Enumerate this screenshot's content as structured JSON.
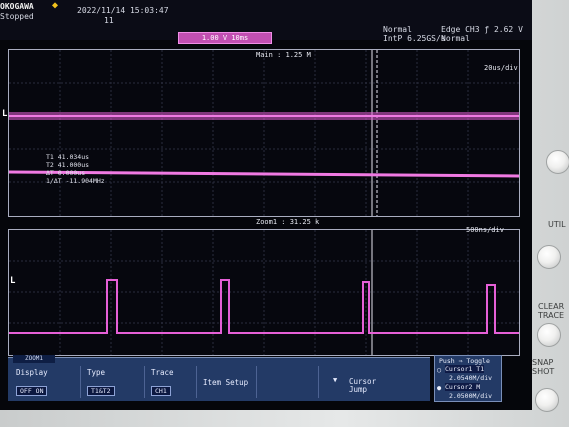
{
  "header": {
    "brand": "OKOGAWA",
    "run_state": "Stopped",
    "datetime": "2022/11/14 15:03:47",
    "acq_count": "11",
    "trigger_bar": "1.00 V 10ms",
    "acq_mode": "Normal",
    "sample_rate": "IntP 6.25GS/s",
    "trigger_info": "Edge CH3 ƒ 2.62 V",
    "trigger_mode": "Normal"
  },
  "main_window": {
    "title": "Main : 1.25 M",
    "time_div": "20us/div",
    "marker": "L"
  },
  "cursor_readout": {
    "t1": "T1  41.034us",
    "t2": "T2  41.000us",
    "dt": "ΔT  0.000us",
    "inv_dt": "1/ΔT  -11.904MHz"
  },
  "zoom_window": {
    "title": "Zoom1 : 31.25 k",
    "time_div": "500ns/div",
    "marker": "L"
  },
  "menu": {
    "title": "ZOOM1",
    "items": [
      {
        "heading": "Display",
        "value": "OFF  ON"
      },
      {
        "heading": "Type",
        "value": "T1&T2"
      },
      {
        "heading": "Trace",
        "value": "CH1"
      },
      {
        "heading": "Item Setup",
        "value": ""
      },
      {
        "heading": "",
        "value": ""
      },
      {
        "heading": "Cursor Jump",
        "value": ""
      }
    ]
  },
  "readout_box": {
    "line1": "Push ⇒ Toggle",
    "line2": "Cursor1 T1",
    "line3": "2.0540M/div",
    "line4": "Cursor2 M",
    "line5": "2.0500M/div"
  },
  "front_panel": {
    "buttons": [
      "UTIL",
      "CLEAR TRACE",
      "SNAP SHOT"
    ]
  },
  "colors": {
    "waveform": "#e55fd7",
    "menu_bg": "#233a66",
    "brand_mark": "#f3c21d"
  }
}
